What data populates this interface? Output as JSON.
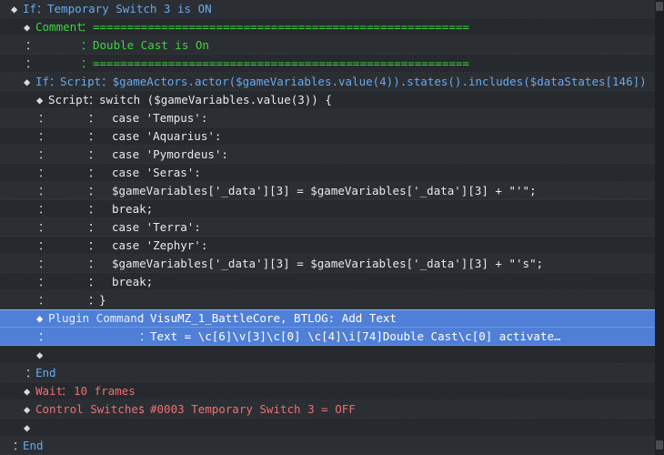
{
  "lines": [
    {
      "marker": "◆",
      "label": "If",
      "sep": "：",
      "value": "Temporary Switch 3 is ON"
    },
    {
      "marker": "◆",
      "label": "Comment",
      "sep": "：",
      "value": "======================================================="
    },
    {
      "marker": "：",
      "sep": "：",
      "value": "Double Cast is On"
    },
    {
      "marker": "：",
      "sep": "：",
      "value": "======================================================="
    },
    {
      "marker": "◆",
      "label": "If",
      "sep": "：",
      "value": "Script：$gameActors.actor($gameVariables.value(4)).states().includes($dataStates[146])"
    },
    {
      "marker": "◆",
      "label": "Script",
      "sep": "：",
      "value": "switch ($gameVariables.value(3)) {"
    },
    {
      "marker": "：",
      "sep": "：",
      "value": "case 'Tempus':"
    },
    {
      "marker": "：",
      "sep": "：",
      "value": "case 'Aquarius':"
    },
    {
      "marker": "：",
      "sep": "：",
      "value": "case 'Pymordeus':"
    },
    {
      "marker": "：",
      "sep": "：",
      "value": "case 'Seras':"
    },
    {
      "marker": "：",
      "sep": "：",
      "value": "$gameVariables['_data'][3] = $gameVariables['_data'][3] + \"'\";"
    },
    {
      "marker": "：",
      "sep": "：",
      "value": "break;"
    },
    {
      "marker": "：",
      "sep": "：",
      "value": "case 'Terra':"
    },
    {
      "marker": "：",
      "sep": "：",
      "value": "case 'Zephyr':"
    },
    {
      "marker": "：",
      "sep": "：",
      "value": "$gameVariables['_data'][3] = $gameVariables['_data'][3] + \"'s\";"
    },
    {
      "marker": "：",
      "sep": "：",
      "value": "break;"
    },
    {
      "marker": "：",
      "sep": "：",
      "value": "}"
    },
    {
      "marker": "◆",
      "label": "Plugin Command",
      "sep": "：",
      "value": "VisuMZ_1_BattleCore, BTLOG: Add Text"
    },
    {
      "marker": "：",
      "sep": "：",
      "value": "Text = \\c[6]\\v[3]\\c[0] \\c[4]\\i[74]Double Cast\\c[0] activate…"
    },
    {
      "marker": "◆"
    },
    {
      "marker": "：",
      "label": "End"
    },
    {
      "marker": "◆",
      "label": "Wait",
      "sep": "：",
      "value": "10 frames"
    },
    {
      "marker": "◆",
      "label": "Control Switches",
      "sep": "：",
      "value": "#0003 Temporary Switch 3 = OFF"
    },
    {
      "marker": "◆"
    },
    {
      "marker": "：",
      "label": "End"
    }
  ],
  "colors": {
    "background": "#22262b",
    "selection": "#4f7fd6",
    "if_label": "#68a8ee",
    "comment": "#3ed43e",
    "wait_control": "#ee6f70",
    "script_text": "#e8e8e8"
  }
}
